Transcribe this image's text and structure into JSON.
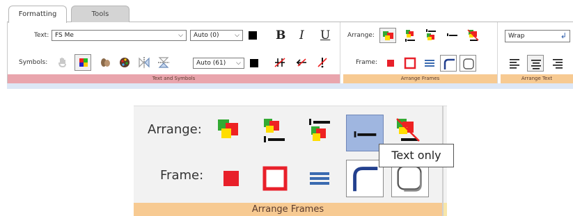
{
  "tabs": [
    {
      "label": "Formatting",
      "active": true
    },
    {
      "label": "Tools",
      "active": false
    }
  ],
  "text_group": {
    "text_label": "Text:",
    "font_value": "FS Me",
    "size_value": "Auto (0)",
    "bold": "B",
    "italic": "I",
    "underline": "U",
    "symbols_label": "Symbols:",
    "symbol_size_value": "Auto (61)",
    "group_label": "Text and Symbols"
  },
  "frames_group": {
    "arrange_label": "Arrange:",
    "frame_label": "Frame:",
    "group_label": "Arrange Frames"
  },
  "arrange_text_group": {
    "wrap_label": "Wrap",
    "group_label": "Arrange Text"
  },
  "zoom": {
    "arrange_label": "Arrange:",
    "frame_label": "Frame:",
    "group_label": "Arrange Frames",
    "tooltip": "Text only"
  },
  "colors": {
    "text_symbols_band": "#e9a5ad",
    "arrange_band": "#f7ca92",
    "selected_button": "#9fb6e0",
    "frame_red": "#e8202a"
  }
}
